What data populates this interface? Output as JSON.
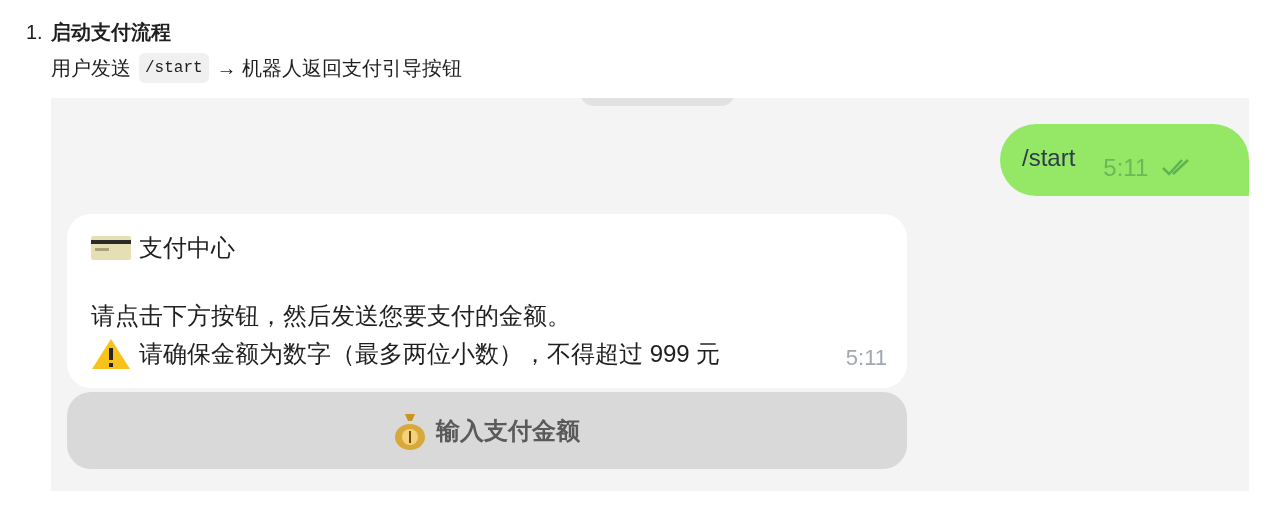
{
  "step": {
    "number": "1.",
    "title": "启动支付流程",
    "desc_before": "用户发送",
    "code": "/start",
    "desc_after": "→ 机器人返回支付引导按钮"
  },
  "chat": {
    "outgoing": {
      "text": "/start",
      "time": "5:11",
      "read": true
    },
    "incoming": {
      "title": "支付中心",
      "lines": [
        "请点击下方按钮，然后发送您要支付的金额。",
        "请确保金额为数字（最多两位小数），不得超过 999 元"
      ],
      "time": "5:11"
    },
    "button": {
      "label": "输入支付金额"
    }
  }
}
